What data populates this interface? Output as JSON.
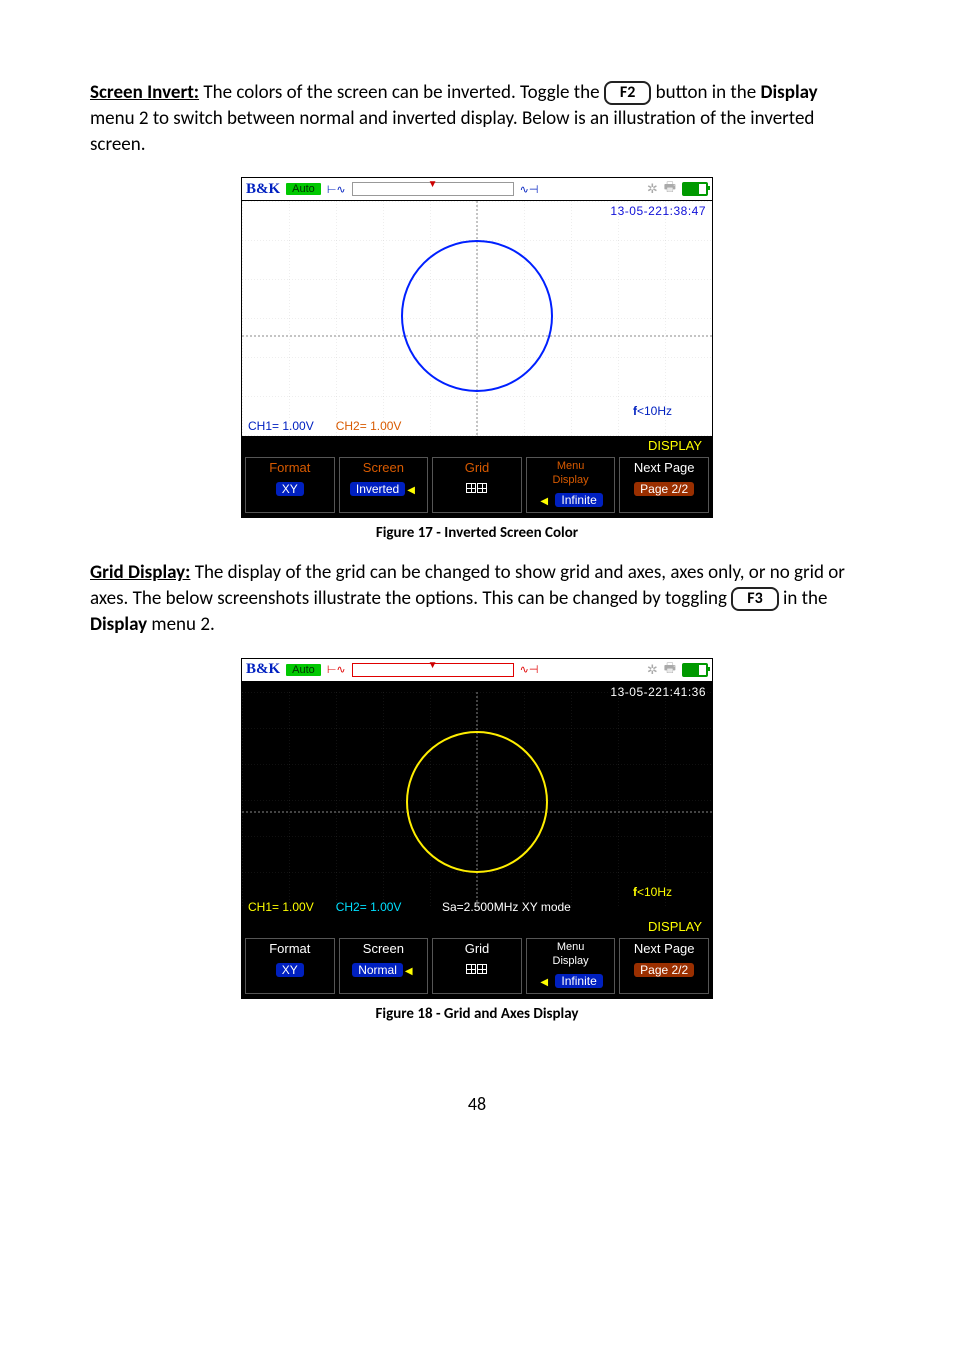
{
  "section1": {
    "title": "Screen Invert:",
    "text_before_key": "The colors of the screen can be inverted.  Toggle the",
    "key": "F2",
    "text_after_key_1": "button in the",
    "menu_name": "Display",
    "text_after_key_2": "menu 2 to switch between normal and inverted display.  Below is an illustration of the inverted screen."
  },
  "fig17": {
    "caption": "Figure 17 - Inverted Screen Color",
    "brand": "B&K",
    "mode": "Auto",
    "timestamp": "13-05-221:38:47",
    "freq": "<10Hz",
    "freq_prefix": "f",
    "ch1": "CH1= 1.00V",
    "ch2": "CH2= 1.00V",
    "disp_label": "DISPLAY",
    "menu": {
      "format_lbl": "Format",
      "format_val": "XY",
      "screen_lbl": "Screen",
      "screen_val": "Inverted",
      "grid_lbl": "Grid",
      "menu_disp_lbl1": "Menu",
      "menu_disp_lbl2": "Display",
      "menu_disp_val": "Infinite",
      "next_lbl": "Next Page",
      "next_val": "Page 2/2"
    }
  },
  "section2": {
    "title": "Grid Display:",
    "text1": "The display of the grid can be changed to show grid and axes, axes only, or no grid or axes.  The below screenshots illustrate the options.  This can be changed by toggling",
    "key": "F3",
    "text2": "in the",
    "menu_name": "Display",
    "text3": "menu 2."
  },
  "fig18": {
    "caption": "Figure 18 - Grid and Axes Display",
    "brand": "B&K",
    "mode": "Auto",
    "timestamp": "13-05-221:41:36",
    "freq": "<10Hz",
    "freq_prefix": "f",
    "ch1": "CH1= 1.00V",
    "ch2": "CH2= 1.00V",
    "sainfo": "Sa=2.500MHz  XY mode",
    "disp_label": "DISPLAY",
    "menu": {
      "format_lbl": "Format",
      "format_val": "XY",
      "screen_lbl": "Screen",
      "screen_val": "Normal",
      "grid_lbl": "Grid",
      "menu_disp_lbl1": "Menu",
      "menu_disp_lbl2": "Display",
      "menu_disp_val": "Infinite",
      "next_lbl": "Next Page",
      "next_val": "Page 2/2"
    }
  },
  "page_number": "48"
}
